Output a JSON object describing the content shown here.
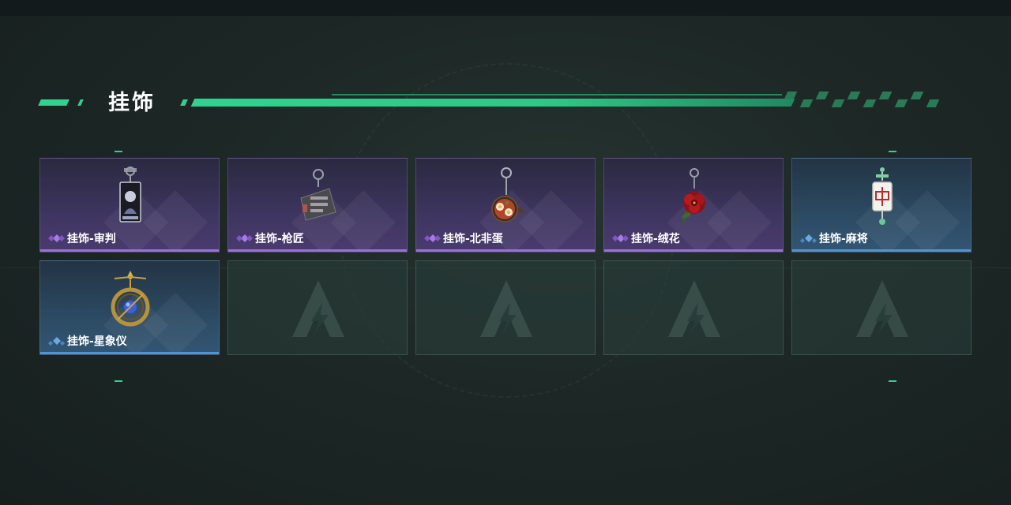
{
  "section": {
    "title": "挂饰"
  },
  "items": [
    {
      "label": "挂饰-审判",
      "rarity": "epic",
      "icon": "tarot-card-charm-icon"
    },
    {
      "label": "挂饰-枪匠",
      "rarity": "epic",
      "icon": "gunsmith-charm-icon"
    },
    {
      "label": "挂饰-北非蛋",
      "rarity": "epic",
      "icon": "shakshuka-pan-charm-icon"
    },
    {
      "label": "挂饰-绒花",
      "rarity": "epic",
      "icon": "velvet-flower-charm-icon"
    },
    {
      "label": "挂饰-麻将",
      "rarity": "rare",
      "icon": "mahjong-tile-charm-icon"
    },
    {
      "label": "挂饰-星象仪",
      "rarity": "rare",
      "icon": "astrolabe-charm-icon"
    }
  ],
  "empty_slots": 4,
  "colors": {
    "accent": "#2fd38f",
    "epic": "#9b6fe0",
    "rare": "#4d95d6"
  }
}
